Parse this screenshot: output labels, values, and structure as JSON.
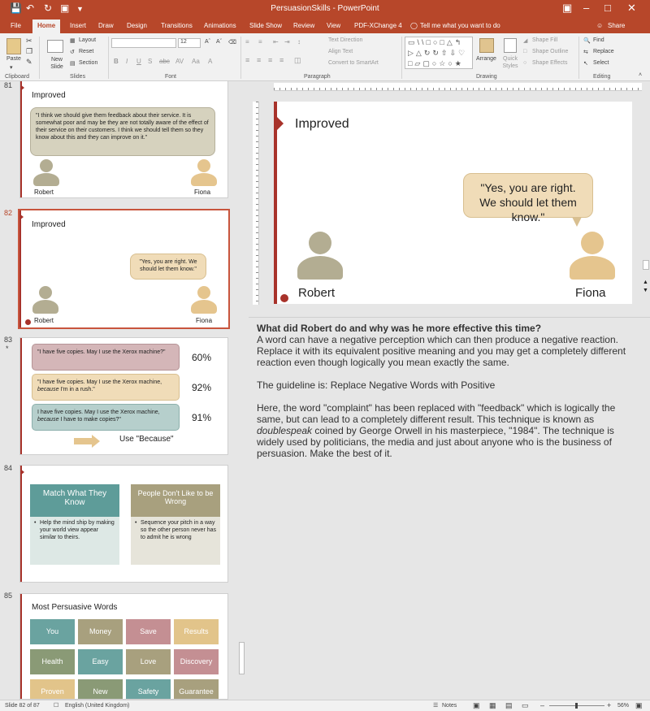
{
  "window": {
    "title": "PersuasionSkills - PowerPoint",
    "share": "Share"
  },
  "tabs": [
    "File",
    "Home",
    "Insert",
    "Draw",
    "Design",
    "Transitions",
    "Animations",
    "Slide Show",
    "Review",
    "View",
    "PDF-XChange 4"
  ],
  "tell_me": "Tell me what you want to do",
  "ribbon": {
    "clipboard": {
      "label": "Clipboard",
      "paste": "Paste"
    },
    "slides": {
      "label": "Slides",
      "new_slide": "New Slide",
      "layout": "Layout",
      "reset": "Reset",
      "section": "Section"
    },
    "font": {
      "label": "Font",
      "size": "12"
    },
    "paragraph": {
      "label": "Paragraph",
      "text_direction": "Text Direction",
      "align_text": "Align Text",
      "convert": "Convert to SmartArt"
    },
    "drawing": {
      "label": "Drawing",
      "arrange": "Arrange",
      "quick_styles": "Quick Styles",
      "shape_fill": "Shape Fill",
      "shape_outline": "Shape Outline",
      "shape_effects": "Shape Effects"
    },
    "editing": {
      "label": "Editing",
      "find": "Find",
      "replace": "Replace",
      "select": "Select"
    }
  },
  "thumbs": {
    "s81": {
      "num": "81",
      "title": "Improved",
      "bubble": "\"I think we should give them feedback about their service. It is somewhat poor and may be they are not totally aware of the effect of their service on their customers. I think we should tell them so they know about this and they can improve on it.\"",
      "left": "Robert",
      "right": "Fiona"
    },
    "s82": {
      "num": "82",
      "title": "Improved",
      "bubble": "\"Yes, you are right. We should let them know.\"",
      "left": "Robert",
      "right": "Fiona"
    },
    "s83": {
      "num": "83",
      "star": "*",
      "rows": [
        {
          "pre": "\"I have five copies. May I use the Xerox machine?\"",
          "em": "",
          "post": "",
          "pct": "60%"
        },
        {
          "pre": "\"I have five copies. May I use the Xerox machine, ",
          "em": "because",
          "post": " I'm in a rush.\"",
          "pct": "92%"
        },
        {
          "pre": "I have five copies. May I use the Xerox machine, ",
          "em": "because",
          "post": " I have to make copies?\"",
          "pct": "91%"
        }
      ],
      "use": "Use \"Because\""
    },
    "s84": {
      "num": "84",
      "left_head": "Match What They Know",
      "left_body": "Help the mind ship by making your world view appear similar to theirs.",
      "right_head": "People Don't Like to be Wrong",
      "right_body": "Sequence your pitch in a way so the other person never has to admit he is wrong"
    },
    "s85": {
      "num": "85",
      "title": "Most Persuasive Words",
      "words": [
        "You",
        "Money",
        "Save",
        "Results",
        "Health",
        "Easy",
        "Love",
        "Discovery",
        "Proven",
        "New",
        "Safety",
        "Guarantee"
      ]
    }
  },
  "main_slide": {
    "title": "Improved",
    "bubble": "\"Yes, you are right. We should let them know.\"",
    "left": "Robert",
    "right": "Fiona"
  },
  "notes": {
    "heading": "What did Robert do and why was he more effective this time?",
    "p1": "A word can have a negative perception which can then produce a negative reaction. Replace it with its equivalent positive meaning and you may get a completely different result. This technique is known as",
    "p1_em": "doublespeak",
    "p1b": "coined by George Orwell in his masterpiece, \"1984\". The technique is widely used by politicians, the media and just about anyone who is the business of persuasion. Make the best of it.",
    "p1_pre": "A word can have a negative perception which can then produce a negative reaction. Replace it with its equivalent positive meaning and you may get a completely different reaction even though logically you mean exactly the same.",
    "p2": "The guideline is: Replace Negative Words with Positive",
    "p3_a": "Here, the word \"complaint\" has been replaced with \"feedback\" which is logically the same, but can lead to a completely different result. This technique is known as",
    "p3_em": "doublespeak",
    "p3_b": "coined by George Orwell in his masterpiece, \"1984\". The technique is widely used by politicians, the media and just about anyone who is the business of persuasion. Make the best of it."
  },
  "status": {
    "slide": "Slide 82 of 87",
    "lang": "English (United Kingdom)",
    "notes": "Notes",
    "zoom": "56%"
  },
  "colors": {
    "accent": "#b7472a",
    "line": "#a8322a",
    "person_left": "#b3ad92",
    "person_right": "#e5c58e"
  }
}
